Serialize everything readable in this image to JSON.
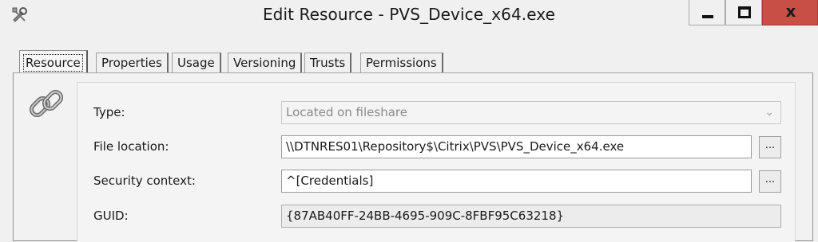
{
  "window": {
    "title": "Edit Resource - PVS_Device_x64.exe",
    "app_icon": "wrench-tools-icon",
    "controls": {
      "minimize_icon": "minimize-icon",
      "maximize_icon": "maximize-icon",
      "close_label": "x"
    },
    "close_color": "#c74f46"
  },
  "tabs": [
    {
      "label": "Resource",
      "active": true
    },
    {
      "label": "Properties",
      "active": false
    },
    {
      "label": "Usage",
      "active": false
    },
    {
      "label": "Versioning",
      "active": false
    },
    {
      "label": "Trusts",
      "active": false
    },
    {
      "label": "Permissions",
      "active": false
    }
  ],
  "resource": {
    "icon": "chain-link-icon",
    "type": {
      "label": "Type:",
      "value": "Located on fileshare"
    },
    "file_location": {
      "label": "File location:",
      "value": "\\\\DTNRES01\\Repository$\\Citrix\\PVS\\PVS_Device_x64.exe",
      "browse_label": "..."
    },
    "security_context": {
      "label": "Security context:",
      "value": "^[Credentials]",
      "browse_label": "..."
    },
    "guid": {
      "label": "GUID:",
      "value": "{87AB40FF-24BB-4695-909C-8FBF95C63218}"
    }
  }
}
